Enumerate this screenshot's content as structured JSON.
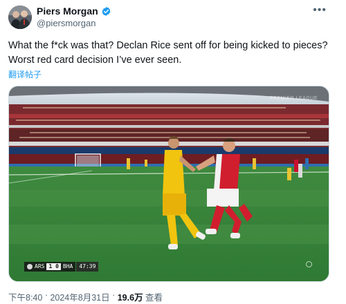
{
  "author": {
    "display_name": "Piers Morgan",
    "handle": "@piersmorgan",
    "verified": true,
    "verified_color": "#1d9bf0"
  },
  "more_icon": "more-horizontal-icon",
  "tweet": {
    "line1": "What the f*ck was that? Declan Rice sent off for being kicked to pieces?",
    "line2": "Worst red card decision I’ve ever seen.",
    "translate_label": "翻译帖子"
  },
  "media": {
    "watermark": "PREMIER LEAGUE",
    "scorebug": {
      "home": "ARS",
      "score": "1 0",
      "away": "BHA",
      "clock": "47:39"
    }
  },
  "meta": {
    "time": "下午8:40",
    "separator": " · ",
    "date": "2024年8月31日",
    "views_count": "19.6万",
    "views_label": " 查看"
  }
}
